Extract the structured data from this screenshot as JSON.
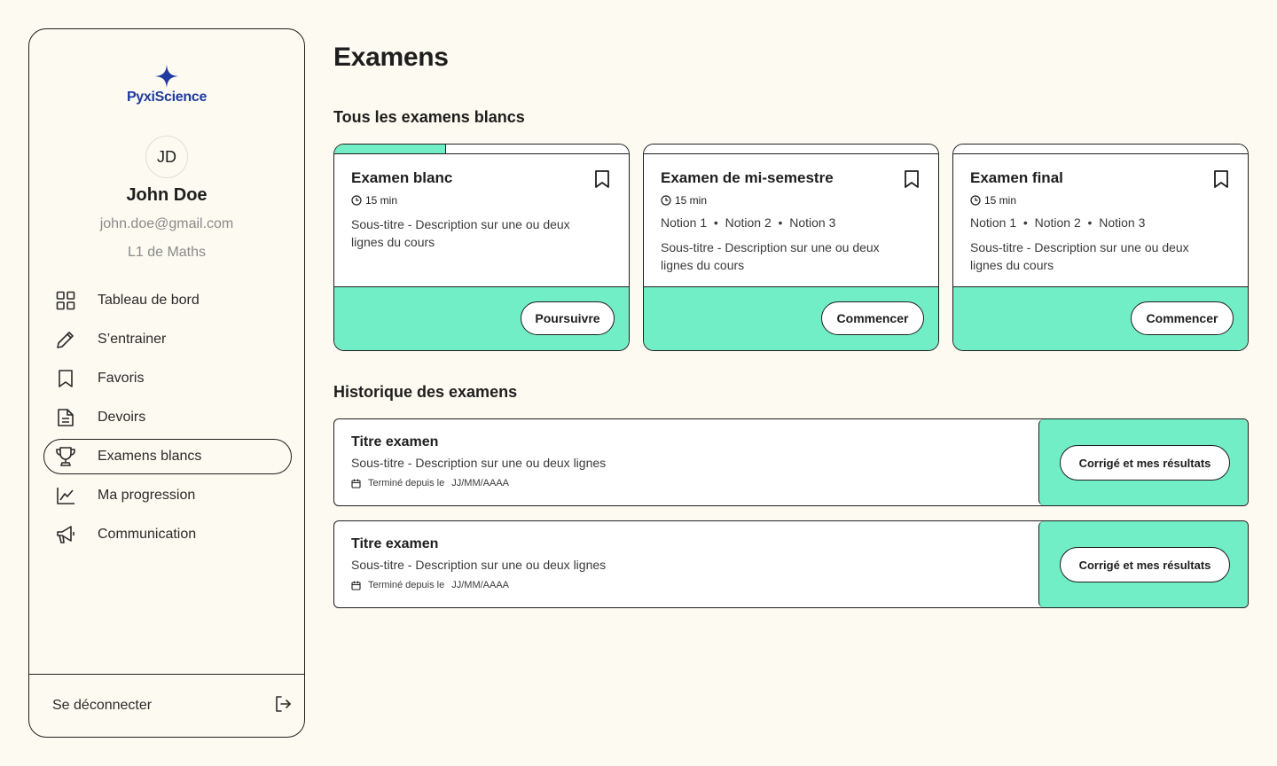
{
  "app": {
    "logo_text": "PyxiScience"
  },
  "user": {
    "initials": "JD",
    "name": "John Doe",
    "email": "john.doe@gmail.com",
    "class": "L1 de Maths"
  },
  "sidebar": {
    "items": [
      {
        "label": "Tableau de bord",
        "icon": "grid-icon"
      },
      {
        "label": "S’entrainer",
        "icon": "pencil-icon"
      },
      {
        "label": "Favoris",
        "icon": "bookmark-icon"
      },
      {
        "label": "Devoirs",
        "icon": "document-icon"
      },
      {
        "label": "Examens blancs",
        "icon": "trophy-icon",
        "active": true
      },
      {
        "label": "Ma progression",
        "icon": "chart-line-icon"
      },
      {
        "label": "Communication",
        "icon": "megaphone-icon"
      }
    ],
    "logout_label": "Se déconnecter"
  },
  "main": {
    "title": "Examens",
    "section_exams": "Tous les examens blancs",
    "section_history": "Historique des examens",
    "exams": [
      {
        "title": "Examen blanc",
        "duration": "15 min",
        "progress": 0.38,
        "desc_line1": "Sous-titre - Description sur une ou deux",
        "desc_line2": "lignes du cours",
        "button": "Poursuivre"
      },
      {
        "title": "Examen de mi-semestre",
        "duration": "15 min",
        "progress": 0,
        "notions": "Notion 1  •  Notion 2  •  Notion 3",
        "desc_line1": "Sous-titre - Description sur une ou deux",
        "desc_line2": "lignes du cours",
        "button": "Commencer"
      },
      {
        "title": "Examen final",
        "duration": "15 min",
        "progress": 0,
        "notions": "Notion 1  •  Notion 2  •  Notion 3",
        "desc_line1": "Sous-titre - Description sur une ou deux",
        "desc_line2": "lignes du cours",
        "button": "Commencer"
      }
    ],
    "history": [
      {
        "title": "Titre examen",
        "desc": "Sous-titre - Description sur une ou deux lignes",
        "date_label": "Terminé depuis le",
        "date_value": "JJ/MM/AAAA",
        "button": "Corrigé et mes résultats"
      },
      {
        "title": "Titre examen",
        "desc": "Sous-titre - Description sur une ou deux lignes",
        "date_label": "Terminé depuis le",
        "date_value": "JJ/MM/AAAA",
        "button": "Corrigé et mes résultats"
      }
    ]
  },
  "colors": {
    "accent": "#72eec6",
    "brand": "#1f3aa0",
    "background": "#fdfaf1",
    "border": "#1e1e1e"
  }
}
